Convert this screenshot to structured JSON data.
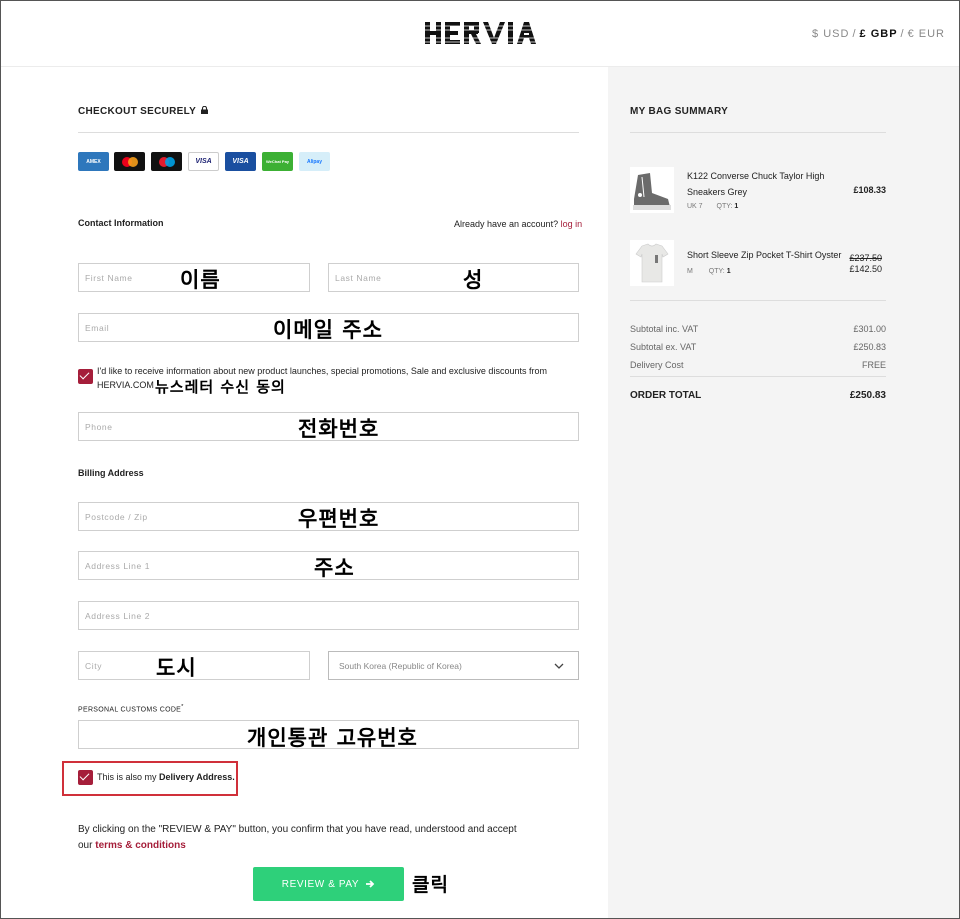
{
  "header": {
    "logo": "HERVIA",
    "currencies": [
      {
        "label": "$ USD",
        "active": false
      },
      {
        "label": "£ GBP",
        "active": true
      },
      {
        "label": "€ EUR",
        "active": false
      }
    ],
    "separator": "/"
  },
  "checkout": {
    "title": "CHECKOUT SECURELY",
    "cards": [
      {
        "name": "amex",
        "color": "#2e77bc",
        "label": "AMEX"
      },
      {
        "name": "mastercard",
        "color": "#111111",
        "label": ""
      },
      {
        "name": "maestro",
        "color": "#111111",
        "label": ""
      },
      {
        "name": "visa",
        "color": "#ffffff",
        "label": "VISA"
      },
      {
        "name": "visa-electron",
        "color": "#1a4fa0",
        "label": "VISA"
      },
      {
        "name": "wechat-pay",
        "color": "#3cb034",
        "label": "WeChat Pay"
      },
      {
        "name": "alipay",
        "color": "#d6eef9",
        "label": "Alipay"
      }
    ],
    "contact_title": "Contact Information",
    "account_prompt": "Already have an account?",
    "login_link": "log in",
    "first_name_placeholder": "First Name",
    "last_name_placeholder": "Last Name",
    "email_placeholder": "Email",
    "newsletter_text_1": "I'd like to receive information about new product launches, special promotions, Sale and exclusive discounts from",
    "newsletter_text_2": "HERVIA.COM",
    "phone_placeholder": "Phone",
    "billing_title": "Billing Address",
    "postcode_placeholder": "Postcode / Zip",
    "address1_placeholder": "Address Line 1",
    "address2_placeholder": "Address Line 2",
    "city_placeholder": "City",
    "country_value": "South Korea (Republic of Korea)",
    "customs_label": "PERSONAL CUSTOMS CODE",
    "customs_required": "*",
    "delivery_text_1": "This is also my ",
    "delivery_text_2": "Delivery Address.",
    "terms_text_1": "By clicking on the \"REVIEW & PAY\" button, you confirm that you have read, understood and accept",
    "terms_text_2": "our ",
    "terms_link": "terms & conditions",
    "review_button": "REVIEW & PAY"
  },
  "annotations": {
    "first_name": "이름",
    "last_name": "성",
    "email": "이메일 주소",
    "newsletter": "뉴스레터 수신 동의",
    "phone": "전화번호",
    "postcode": "우편번호",
    "address": "주소",
    "city": "도시",
    "customs": "개인통관 고유번호",
    "click": "클릭"
  },
  "bag": {
    "title": "MY BAG SUMMARY",
    "items": [
      {
        "name_1": "K122 Converse Chuck Taylor High",
        "name_2": "Sneakers Grey",
        "size": "UK 7",
        "qty_label": "QTY:",
        "qty": "1",
        "price": "£108.33"
      },
      {
        "name_1": "Short Sleeve Zip Pocket T-Shirt Oyster",
        "size": "M",
        "qty_label": "QTY:",
        "qty": "1",
        "old_price": "£237.50",
        "price": "£142.50"
      }
    ],
    "subtotal_inc_label": "Subtotal inc. VAT",
    "subtotal_inc": "£301.00",
    "subtotal_ex_label": "Subtotal ex. VAT",
    "subtotal_ex": "£250.83",
    "delivery_label": "Delivery Cost",
    "delivery": "FREE",
    "total_label": "ORDER TOTAL",
    "total": "£250.83"
  }
}
